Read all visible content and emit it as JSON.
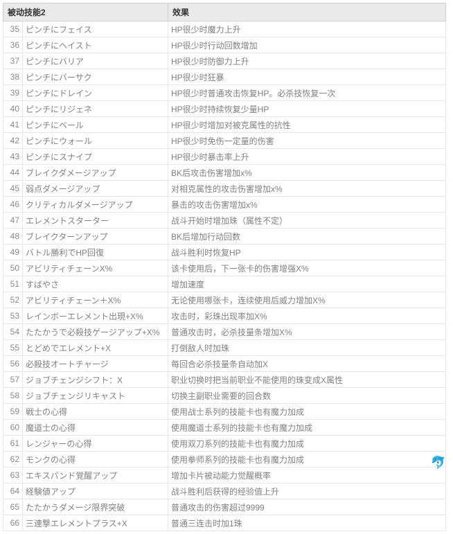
{
  "headers": {
    "skill": "被动技能2",
    "effect": "效果"
  },
  "rows": [
    {
      "n": 35,
      "skill": "ピンチにフェイス",
      "effect": "HP很少时魔力上升"
    },
    {
      "n": 36,
      "skill": "ピンチにヘイスト",
      "effect": "HP很少时行动回数增加"
    },
    {
      "n": 37,
      "skill": "ピンチにバリア",
      "effect": "HP很少时防御力上升"
    },
    {
      "n": 38,
      "skill": "ピンチにバーサク",
      "effect": "HP很少时狂暴"
    },
    {
      "n": 39,
      "skill": "ピンチにドレイン",
      "effect": "HP很少时普通攻击恢复HP。必杀技恢复一次"
    },
    {
      "n": 40,
      "skill": "ピンチにリジェネ",
      "effect": "HP很少时持续恢复少量HP"
    },
    {
      "n": 41,
      "skill": "ピンチにベール",
      "effect": "HP很少时增加对被克属性的抗性"
    },
    {
      "n": 42,
      "skill": "ピンチにウォール",
      "effect": "HP很少时免伤一定量的伤害"
    },
    {
      "n": 43,
      "skill": "ピンチにスナイプ",
      "effect": "HP很少时暴击率上升"
    },
    {
      "n": 44,
      "skill": "ブレイクダメージアップ",
      "effect": "BK后攻击伤害增加x%"
    },
    {
      "n": 45,
      "skill": "弱点ダメージアップ",
      "effect": "对相克属性的攻击伤害增加x%"
    },
    {
      "n": 46,
      "skill": "クリティカルダメージアップ",
      "effect": "暴击的攻击伤害增加x%"
    },
    {
      "n": 47,
      "skill": "エレメントスターター",
      "effect": "战斗开始时增加珠（属性不定）"
    },
    {
      "n": 48,
      "skill": "ブレイクターンアップ",
      "effect": "BK后增加行动回数"
    },
    {
      "n": 49,
      "skill": "バトル勝利でHP回復",
      "effect": "战斗胜利时恢复HP"
    },
    {
      "n": 50,
      "skill": "アビリティチェーンX%",
      "effect": "该卡使用后，下一张卡的伤害增强X%"
    },
    {
      "n": 51,
      "skill": "すばやさ",
      "effect": "增加速度"
    },
    {
      "n": 52,
      "skill": "アビリティチェーン＋X%",
      "effect": "无论使用哪张卡，连续使用后威力增加X%"
    },
    {
      "n": 53,
      "skill": "レインボーエレメント出現+X%",
      "effect": "攻击时，彩珠出现率加X%"
    },
    {
      "n": 54,
      "skill": "たたかうで必殺技ゲージアップ+X%",
      "effect": "普通攻击时，必杀技量条增加X%"
    },
    {
      "n": 55,
      "skill": "とどめでエレメント+X",
      "effect": "打倒敌人时加珠"
    },
    {
      "n": 56,
      "skill": "必殺技オートチャージ",
      "effect": "每回合必杀技量条自动加X"
    },
    {
      "n": 57,
      "skill": "ジョブチェンジシフト：X",
      "effect": "职业切换时把当前职业不能使用的珠变成X属性"
    },
    {
      "n": 58,
      "skill": "ジョブチェンジリキャスト",
      "effect": "切换主副职业需要的回合数"
    },
    {
      "n": 59,
      "skill": "戦士の心得",
      "effect": "使用战士系列的技能卡也有魔力加成"
    },
    {
      "n": 60,
      "skill": "魔道士の心得",
      "effect": "使用魔道士系列的技能卡也有魔力加成"
    },
    {
      "n": 61,
      "skill": "レンジャーの心得",
      "effect": "使用双刀系列的技能卡也有魔力加成"
    },
    {
      "n": 62,
      "skill": "モンクの心得",
      "effect": "使用拳师系列的技能卡也有魔力加成"
    },
    {
      "n": 63,
      "skill": "エキスパンド覚醒アップ",
      "effect": "增加卡片被动能力觉醒概率"
    },
    {
      "n": 64,
      "skill": "経験値アップ",
      "effect": "战斗胜利后获得的经验值上升"
    },
    {
      "n": 65,
      "skill": "たたかうダメージ限界突破",
      "effect": "普通攻击的伤害超过9999"
    },
    {
      "n": 66,
      "skill": "三連撃エレメントプラス+X",
      "effect": "普通三连击时加1珠"
    }
  ],
  "dolphin": "🐬"
}
